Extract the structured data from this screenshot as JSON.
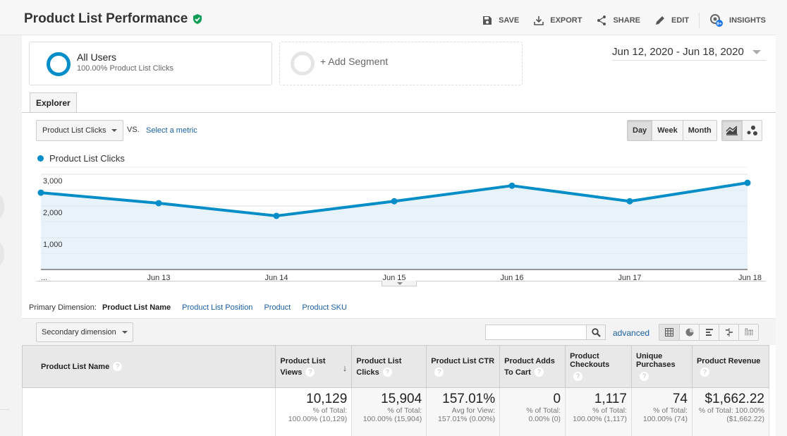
{
  "header": {
    "title": "Product List Performance",
    "toolbar": [
      {
        "icon": "save-icon",
        "label": "SAVE"
      },
      {
        "icon": "export-icon",
        "label": "EXPORT"
      },
      {
        "icon": "share-icon",
        "label": "SHARE"
      },
      {
        "icon": "edit-icon",
        "label": "EDIT"
      },
      {
        "icon": "insights-icon",
        "label": "INSIGHTS",
        "badge": "9+"
      }
    ]
  },
  "segments": {
    "all_users": {
      "name": "All Users",
      "sub": "100.00% Product List Clicks"
    },
    "add_label": "+ Add Segment"
  },
  "date_range": "Jun 12, 2020 - Jun 18, 2020",
  "tabs": [
    {
      "label": "Explorer",
      "active": true
    }
  ],
  "metric_picker": {
    "selected": "Product List Clicks",
    "vs": "VS.",
    "select_metric": "Select a metric"
  },
  "period_buttons": [
    {
      "label": "Day",
      "active": true
    },
    {
      "label": "Week",
      "active": false
    },
    {
      "label": "Month",
      "active": false
    }
  ],
  "chart_type_buttons": [
    {
      "icon": "line-chart-icon",
      "active": true
    },
    {
      "icon": "motion-chart-icon",
      "active": false
    }
  ],
  "colors": {
    "series": "#058dc7",
    "area": "#e5f1f8",
    "link": "#1a5fa3"
  },
  "chart_data": {
    "type": "area",
    "title": "",
    "legend": [
      "Product List Clicks"
    ],
    "legend_position": "top-left",
    "x": [
      "...",
      "Jun 13",
      "Jun 14",
      "Jun 15",
      "Jun 16",
      "Jun 17",
      "Jun 18"
    ],
    "categories": [
      "Jun 12",
      "Jun 13",
      "Jun 14",
      "Jun 15",
      "Jun 16",
      "Jun 17",
      "Jun 18"
    ],
    "series": [
      {
        "name": "Product List Clicks",
        "values": [
          2420,
          2090,
          1690,
          2150,
          2640,
          2150,
          2730
        ]
      }
    ],
    "yticks": [
      "3,000",
      "2,000",
      "1,000"
    ],
    "ytick_values": [
      3000,
      2000,
      1000
    ],
    "ylim": [
      0,
      3000
    ],
    "grid": true
  },
  "primary_dimension": {
    "label": "Primary Dimension:",
    "active": "Product List Name",
    "options": [
      "Product List Position",
      "Product",
      "Product SKU"
    ]
  },
  "filter_bar": {
    "secondary_dimension": "Secondary dimension",
    "search_value": "",
    "advanced": "advanced",
    "views": [
      "table-view-icon",
      "pie-view-icon",
      "performance-view-icon",
      "comparison-view-icon",
      "pivot-view-icon"
    ]
  },
  "table": {
    "columns": [
      {
        "label": "Product List Name",
        "help": "?"
      },
      {
        "label": "Product List Views",
        "help": "?",
        "sorted": true
      },
      {
        "label": "Product List Clicks",
        "help": "?"
      },
      {
        "label": "Product List CTR",
        "help": "?"
      },
      {
        "label": "Product Adds To Cart",
        "help": "?"
      },
      {
        "label": "Product Checkouts",
        "help": "?"
      },
      {
        "label": "Unique Purchases",
        "help": "?"
      },
      {
        "label": "Product Revenue",
        "help": "?"
      }
    ],
    "totals": [
      {
        "value": "10,129",
        "sub1": "% of Total:",
        "sub2": "100.00% (10,129)"
      },
      {
        "value": "15,904",
        "sub1": "% of Total:",
        "sub2": "100.00% (15,904)"
      },
      {
        "value": "157.01%",
        "sub1": "Avg for View:",
        "sub2": "157.01% (0.00%)"
      },
      {
        "value": "0",
        "sub1": "% of Total:",
        "sub2": "0.00% (0)"
      },
      {
        "value": "1,117",
        "sub1": "% of Total:",
        "sub2": "100.00% (1,117)"
      },
      {
        "value": "74",
        "sub1": "% of Total:",
        "sub2": "100.00% (74)"
      },
      {
        "value": "$1,662.22",
        "sub1": "% of Total: 100.00%",
        "sub2": "($1,662.22)"
      }
    ]
  }
}
